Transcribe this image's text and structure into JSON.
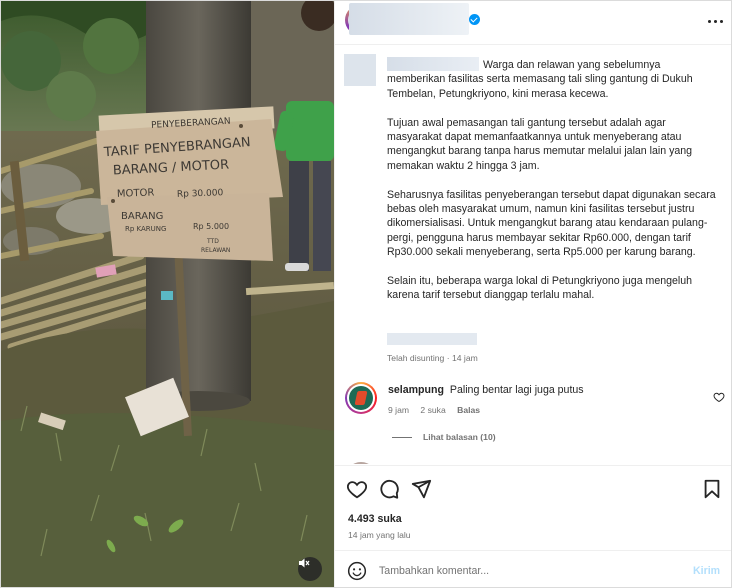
{
  "post": {
    "caption": {
      "intro": "Warga dan relawan yang sebelumnya memberikan fasilitas serta memasang tali sling gantung di Dukuh Tembelan, Petungkriyono, kini merasa kecewa.",
      "para2": "Tujuan awal pemasangan tali gantung tersebut adalah agar masyarakat dapat memanfaatkannya untuk menyeberang atau mengangkut barang tanpa harus memutar melalui jalan lain yang memakan waktu 2 hingga 3 jam.",
      "para3": "Seharusnya fasilitas penyeberangan tersebut dapat digunakan secara bebas oleh masyarakat umum, namun kini fasilitas tersebut justru dikomersialisasi. Untuk mengangkut barang atau kendaraan pulang-pergi, pengguna harus membayar sekitar Rp60.000, dengan tarif Rp30.000 sekali menyeberang, serta Rp5.000 per karung barang.",
      "para4": "Selain itu, beberapa warga lokal di Petungkriyono juga mengeluh karena tarif tersebut dianggap terlalu mahal.",
      "meta": "Telah disunting · 14 jam"
    },
    "comment": {
      "username": "selampung",
      "text": "Paling bentar lagi juga putus",
      "time": "9 jam",
      "likes": "2 suka",
      "reply": "Balas",
      "view_replies": "Lihat balasan (10)"
    },
    "likes": "4.493 suka",
    "time_ago": "14 jam yang lalu",
    "add_comment": {
      "placeholder": "Tambahkan komentar...",
      "post_label": "Kirim"
    }
  },
  "photo": {
    "sign": {
      "header": "PENYEBERANGAN",
      "title_line1": "TARIF PENYEBRANGAN",
      "title_line2": "BARANG / MOTOR",
      "motor_label": "MOTOR",
      "motor_price": "Rp 30.000",
      "barang_label": "BARANG",
      "barang_unit": "Rp KARUNG",
      "barang_price": "Rp 5.000",
      "sign_off1": "TTD",
      "sign_off2": "RELAWAN"
    }
  },
  "icons": {
    "heart": "heart-icon",
    "comment": "comment-icon",
    "share": "share-icon",
    "bookmark": "bookmark-icon",
    "more": "more-icon",
    "emoji": "emoji-icon",
    "mute": "mute-icon",
    "verified": "verified-icon"
  }
}
